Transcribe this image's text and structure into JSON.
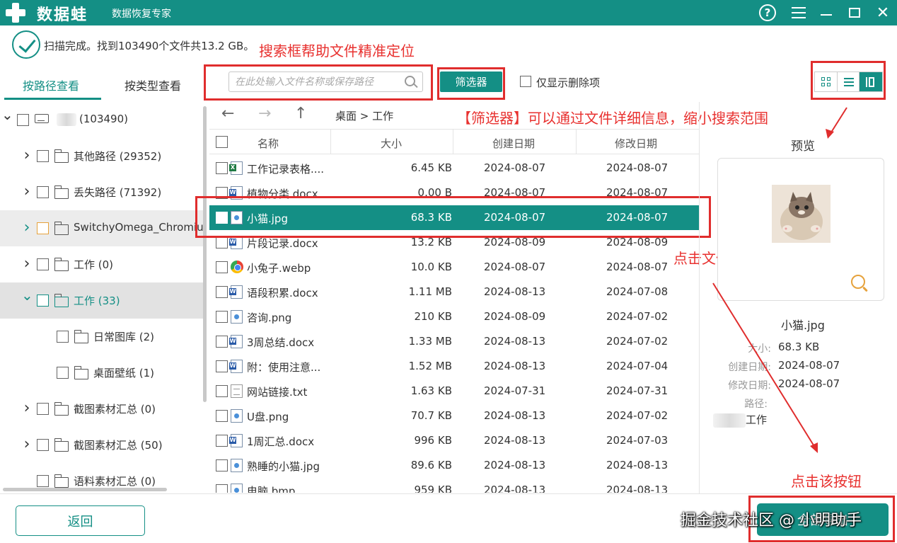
{
  "titlebar": {
    "app_name": "数据蛙",
    "subtitle": "数据恢复专家",
    "icons": [
      "help-icon",
      "menu-icon",
      "minimize-icon",
      "maximize-icon",
      "close-icon"
    ],
    "close_glyph": "✕"
  },
  "status": {
    "text": "扫描完成。找到103490个文件共13.2 GB。"
  },
  "annotations": {
    "search": "搜索框帮助文件精准定位",
    "filter": "【筛选器】可以通过文件详细信息，缩小搜索范围",
    "click_file": "点击文件，选中",
    "click_button": "点击该按钮"
  },
  "tabs": {
    "by_path": "按路径查看",
    "by_type": "按类型查看"
  },
  "search": {
    "placeholder": "在此处输入文件名称或保存路径"
  },
  "filter": {
    "label": "筛选器"
  },
  "deleted_only": {
    "label": "仅显示删除项",
    "checked": false
  },
  "tree": [
    {
      "label": "(103490)",
      "expanded": true,
      "type": "drive"
    },
    {
      "label": "其他路径 (29352)",
      "expanded": false,
      "type": "folder"
    },
    {
      "label": "丢失路径 (71392)",
      "expanded": false,
      "type": "folder"
    },
    {
      "label": "SwitchyOmega_Chromium",
      "expanded": false,
      "type": "folder"
    },
    {
      "label": "工作 (0)",
      "expanded": false,
      "type": "folder"
    },
    {
      "label": "工作 (33)",
      "expanded": true,
      "type": "folder"
    },
    {
      "label": "日常图库 (2)",
      "type": "folder"
    },
    {
      "label": "桌面壁纸 (1)",
      "type": "folder"
    },
    {
      "label": "截图素材汇总 (0)",
      "expanded": false,
      "type": "folder"
    },
    {
      "label": "截图素材汇总 (50)",
      "expanded": false,
      "type": "folder"
    },
    {
      "label": "语料素材汇总 (0)",
      "type": "folder"
    }
  ],
  "nav": {
    "back_glyph": "←",
    "forward_glyph": "→",
    "up_glyph": "↑",
    "breadcrumb": "桌面 > 工作"
  },
  "columns": {
    "name": "名称",
    "size": "大小",
    "created": "创建日期",
    "modified": "修改日期"
  },
  "files": [
    {
      "icon": "xls",
      "name": "工作记录表格....",
      "size": "6.45 KB",
      "created": "2024-08-07",
      "modified": "2024-08-07"
    },
    {
      "icon": "doc",
      "name": "植物分类.docx",
      "size": "0.00  B",
      "created": "2024-08-07",
      "modified": "2024-08-07"
    },
    {
      "icon": "img",
      "name": "小猫.jpg",
      "size": "68.3 KB",
      "created": "2024-08-07",
      "modified": "2024-08-07",
      "selected": true
    },
    {
      "icon": "doc",
      "name": "片段记录.docx",
      "size": "13.2 KB",
      "created": "2024-08-09",
      "modified": "2024-08-09"
    },
    {
      "icon": "web",
      "name": "小兔子.webp",
      "size": "10.0 KB",
      "created": "2024-08-07",
      "modified": "2024-08-07"
    },
    {
      "icon": "doc",
      "name": "语段积累.docx",
      "size": "1.11 MB",
      "created": "2024-08-13",
      "modified": "2024-07-08"
    },
    {
      "icon": "img",
      "name": "咨询.png",
      "size": "210 KB",
      "created": "2024-08-09",
      "modified": "2024-07-02"
    },
    {
      "icon": "doc",
      "name": "3周总结.docx",
      "size": "1.33 MB",
      "created": "2024-08-13",
      "modified": "2024-07-02"
    },
    {
      "icon": "doc",
      "name": "附：使用注意...",
      "size": "1.52 MB",
      "created": "2024-08-13",
      "modified": "2024-07-04"
    },
    {
      "icon": "txt",
      "name": "网站链接.txt",
      "size": "1.63 KB",
      "created": "2024-07-31",
      "modified": "2024-07-31"
    },
    {
      "icon": "img",
      "name": "U盘.png",
      "size": "70.7 KB",
      "created": "2024-08-13",
      "modified": "2024-07-02"
    },
    {
      "icon": "doc",
      "name": "1周汇总.docx",
      "size": "996 KB",
      "created": "2024-08-13",
      "modified": "2024-07-03"
    },
    {
      "icon": "img",
      "name": "熟睡的小猫.jpg",
      "size": "89.6 KB",
      "created": "2024-08-13",
      "modified": "2024-08-13"
    },
    {
      "icon": "img",
      "name": "电脑.bmp",
      "size": "959 KB",
      "created": "2024-08-13",
      "modified": "2024-08-13"
    }
  ],
  "preview": {
    "title": "预览",
    "file_name": "小猫.jpg",
    "size_key": "大小:",
    "size": "68.3 KB",
    "created_key": "创建日期:",
    "created": "2024-08-07",
    "modified_key": "修改日期:",
    "modified": "2024-08-07",
    "path_key": "路径:",
    "path": "工作"
  },
  "buttons": {
    "back": "返回",
    "export": "全部导出"
  },
  "watermark": "掘金技术社区 @ 小明助手",
  "colors": {
    "accent": "#148f85",
    "annotation": "#e8312f",
    "zoom": "#e6a23c"
  }
}
